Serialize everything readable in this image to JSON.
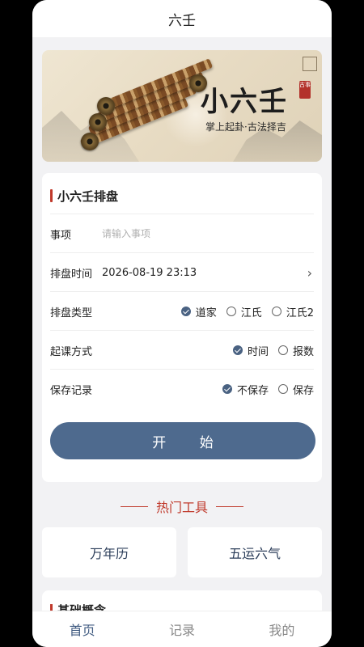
{
  "header": {
    "title": "六壬"
  },
  "banner": {
    "title": "小六壬",
    "slogan": "掌上起卦·古法择吉",
    "seal": "古事"
  },
  "form": {
    "title": "小六壬排盘",
    "matter": {
      "label": "事项",
      "placeholder": "请输入事项",
      "value": ""
    },
    "time": {
      "label": "排盘时间",
      "value": "2026-08-19 23:13"
    },
    "type": {
      "label": "排盘类型",
      "options": [
        "道家",
        "江氏",
        "江氏2"
      ],
      "selected": "道家"
    },
    "method": {
      "label": "起课方式",
      "options": [
        "时间",
        "报数"
      ],
      "selected": "时间"
    },
    "save": {
      "label": "保存记录",
      "options": [
        "不保存",
        "保存"
      ],
      "selected": "不保存"
    },
    "start_label": "开 始"
  },
  "tools": {
    "heading": "热门工具",
    "items": [
      "万年历",
      "五运六气"
    ]
  },
  "next_section": {
    "title": "基础概念"
  },
  "tabbar": {
    "items": [
      "首页",
      "记录",
      "我的"
    ],
    "active": "首页"
  },
  "colors": {
    "accent": "#4e6a8e",
    "red": "#c0392b",
    "bg": "#f2f2f4"
  }
}
